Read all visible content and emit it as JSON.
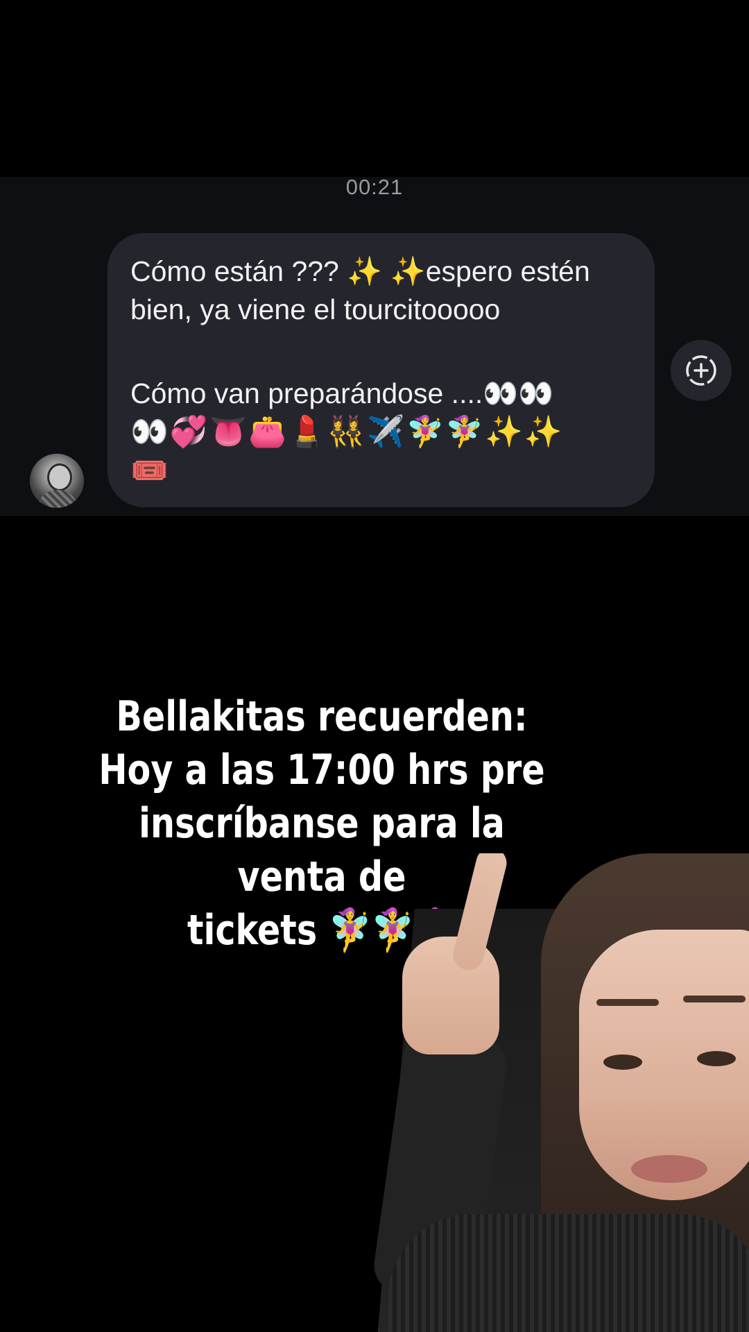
{
  "chat": {
    "timestamp": "00:21",
    "message": {
      "line1": "Cómo están ??? ✨ ✨espero estén",
      "line2": "bien, ya viene el tourcitooooo",
      "line3": "Cómo van preparándose ....👀👀",
      "line4": "👀💞👅👛💄👯‍♀️✈️🧚‍♀️🧚‍♀️✨✨",
      "line5": "🎟️"
    },
    "react_button_icon": "add-reaction-icon"
  },
  "caption": {
    "line1": "Bellakitas recuerden:",
    "line2": "Hoy a las 17:00 hrs pre",
    "line3": "inscríbanse para la venta de",
    "line4": "tickets 🧚‍♀️🧚‍♀️🧚‍♀️"
  },
  "colors": {
    "background": "#000000",
    "chat_panel": "#0d0f13",
    "bubble": "#25262d",
    "timestamp": "#9a9ba1",
    "text": "#f2f2f4"
  }
}
